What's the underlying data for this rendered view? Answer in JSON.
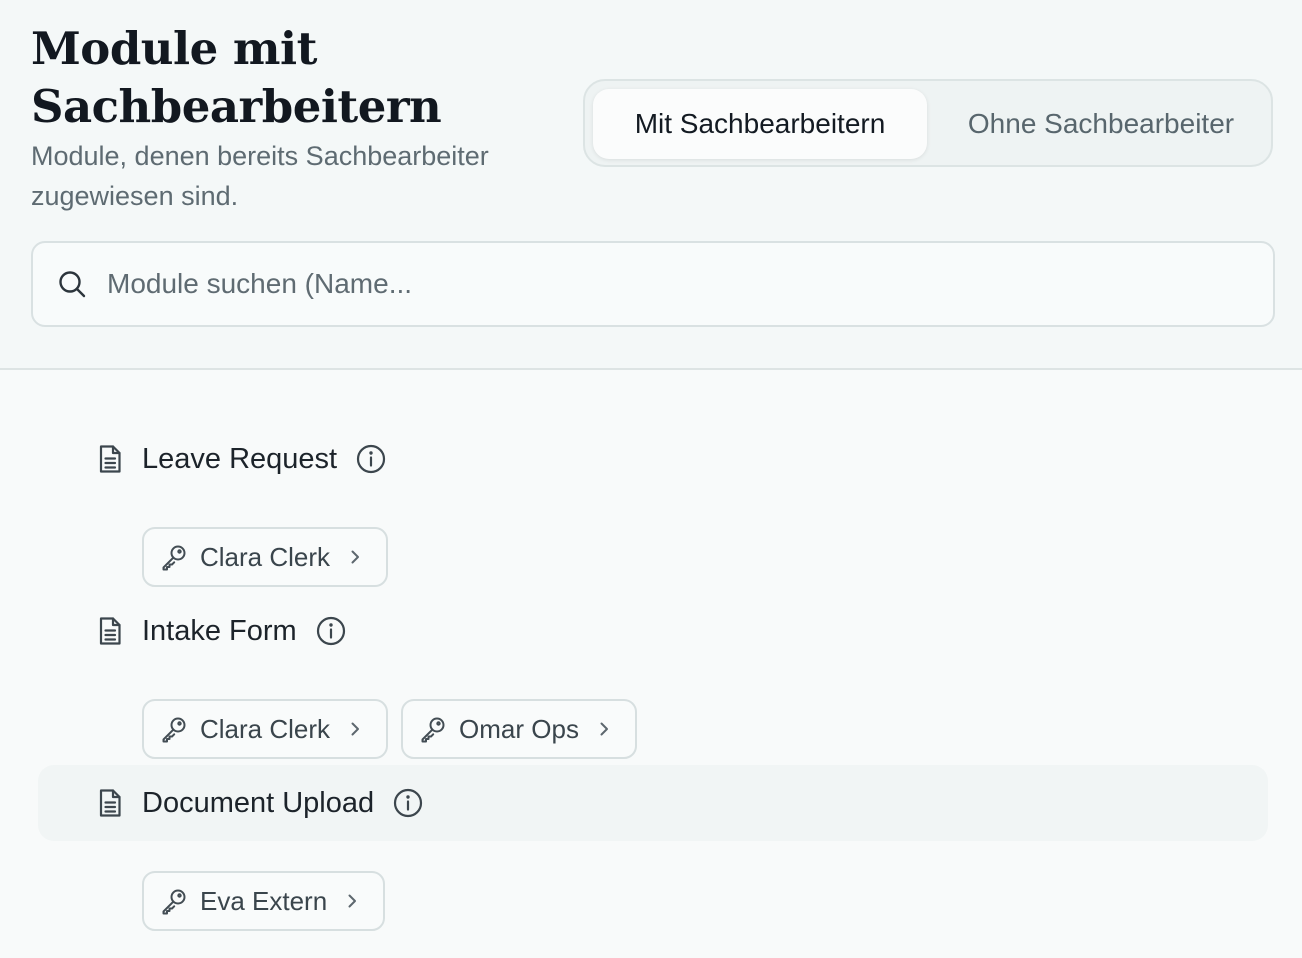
{
  "header": {
    "title": "Module mit Sachbearbeitern",
    "subtitle": "Module, denen bereits Sachbearbeiter zugewiesen sind.",
    "toggle": {
      "active_label": "Mit Sachbearbeitern",
      "inactive_label": "Ohne Sachbearbeiter"
    },
    "search": {
      "placeholder": "Module suchen (Name...",
      "value": ""
    }
  },
  "modules": [
    {
      "name": "Leave Request",
      "clerks": [
        "Clara Clerk"
      ]
    },
    {
      "name": "Intake Form",
      "clerks": [
        "Clara Clerk",
        "Omar Ops"
      ]
    },
    {
      "name": "Document Upload",
      "clerks": [
        "Eva Extern"
      ]
    }
  ]
}
